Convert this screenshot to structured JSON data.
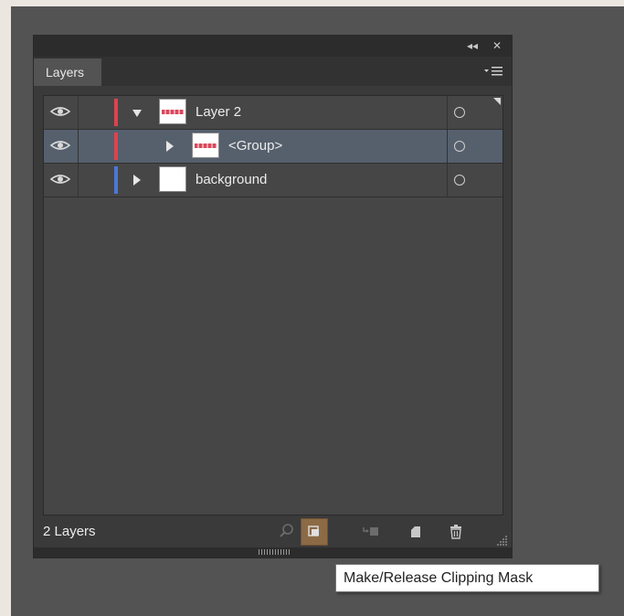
{
  "panel": {
    "title": "Layers",
    "collapse_glyph": "◂◂",
    "close_glyph": "✕"
  },
  "layers": [
    {
      "name": "Layer 2",
      "color": "#e0424d",
      "expanded": true,
      "selected": false,
      "indent": 0,
      "has_art": true
    },
    {
      "name": "<Group>",
      "color": "#e0424d",
      "expanded": false,
      "selected": true,
      "indent": 1,
      "has_art": true
    },
    {
      "name": "background",
      "color": "#4a78d8",
      "expanded": false,
      "selected": false,
      "indent": 0,
      "has_art": false
    }
  ],
  "footer": {
    "layer_count": "2 Layers",
    "buttons": [
      "locate-object",
      "make-release-clipping-mask",
      "create-sublayer",
      "create-new-layer",
      "delete-selection"
    ]
  },
  "tooltip": "Make/Release Clipping Mask"
}
